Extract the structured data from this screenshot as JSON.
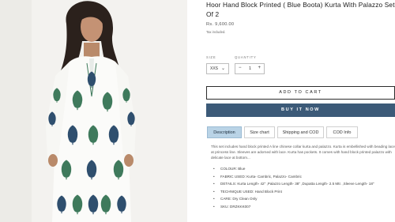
{
  "product": {
    "title": "Hoor Hand Block Printed ( Blue Boota) Kurta With Palazzo Set Of 2",
    "price": "Rs. 9,600.00",
    "tax_note": "Tax included."
  },
  "options": {
    "size_label": "SIZE",
    "size_value": "XXS",
    "quantity_label": "QUANTITY",
    "quantity_value": "1"
  },
  "actions": {
    "add_to_cart": "ADD TO CART",
    "buy_now": "BUY IT NOW"
  },
  "tabs": [
    {
      "label": "Description",
      "active": true
    },
    {
      "label": "Size chart",
      "active": false
    },
    {
      "label": "Shipping and COD",
      "active": false
    },
    {
      "label": "COD Info",
      "active": false
    }
  ],
  "description": {
    "text": "This set includes hand block printed A line chinese collar kurta and palazzo. Kurta is embellished with beading lace at princess line. Sleeves are adorned with lace. Kurta has pockets. It comes with hand block printed palazzo with delicate lace at bottom...",
    "bullets": [
      "COLOUR: Blue",
      "FABRIC USED: Kurta- Cambric, Palazzo- Cambric",
      "DETAILS: Kurta Length- 42\" ,Palazzo Length- 38\" ,Dupatta Length- 2.5 Mtr. ,Sleeve Length- 18\"",
      "TECHNIQUE USED: Hand Block Print",
      "CARE: Dry Clean Only",
      "SKU: DRZKKK007"
    ]
  },
  "colors": {
    "accent": "#3c5a78",
    "tab_active": "#b9d3e6",
    "print_green": "#3f7a5c",
    "print_blue": "#2f4f6e"
  }
}
